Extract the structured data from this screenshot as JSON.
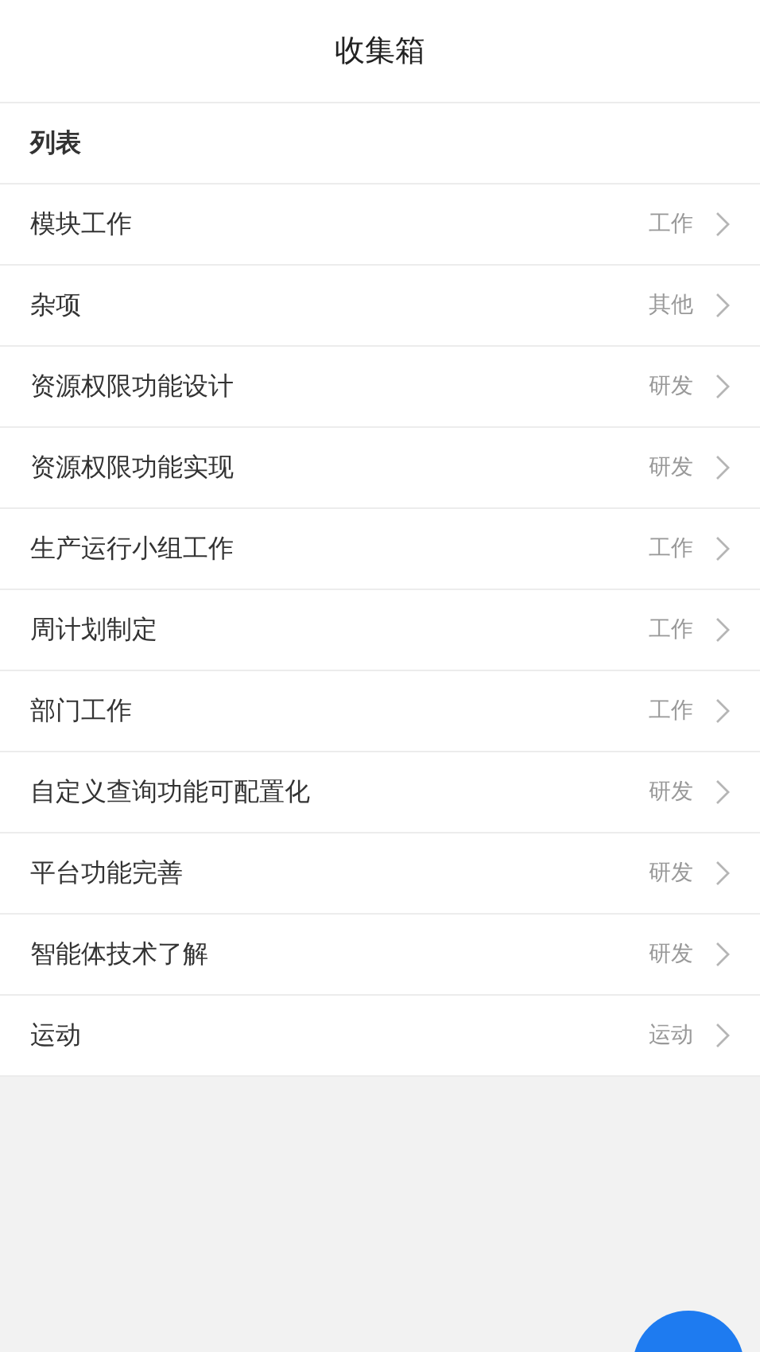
{
  "header": {
    "title": "收集箱"
  },
  "list": {
    "heading": "列表",
    "items": [
      {
        "name": "模块工作",
        "category": "工作"
      },
      {
        "name": "杂项",
        "category": "其他"
      },
      {
        "name": "资源权限功能设计",
        "category": "研发"
      },
      {
        "name": "资源权限功能实现",
        "category": "研发"
      },
      {
        "name": "生产运行小组工作",
        "category": "工作"
      },
      {
        "name": "周计划制定",
        "category": "工作"
      },
      {
        "name": "部门工作",
        "category": "工作"
      },
      {
        "name": "自定义查询功能可配置化",
        "category": "研发"
      },
      {
        "name": "平台功能完善",
        "category": "研发"
      },
      {
        "name": "智能体技术了解",
        "category": "研发"
      },
      {
        "name": "运动",
        "category": "运动"
      }
    ]
  }
}
